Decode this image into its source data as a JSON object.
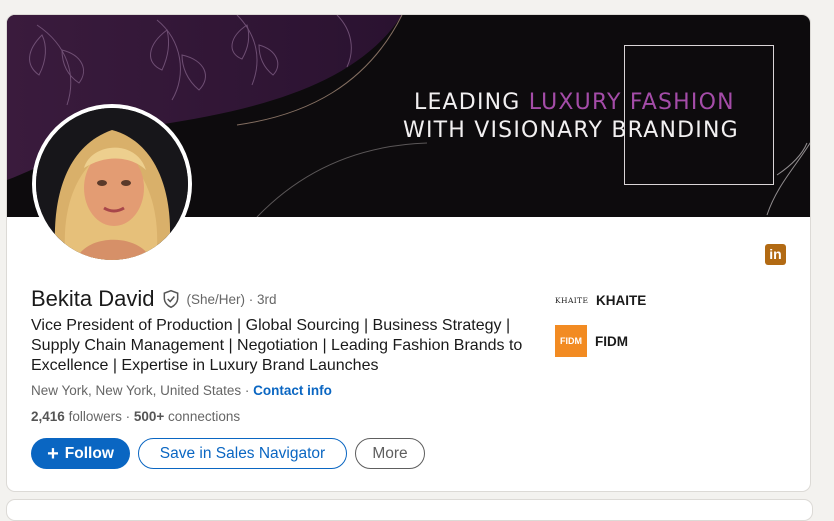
{
  "banner": {
    "line1_plain": "LEADING ",
    "line1_accent": "LUXURY FASHION",
    "line2": "WITH VISIONARY BRANDING",
    "accent_color": "#a44ca8"
  },
  "profile": {
    "name": "Bekita David",
    "pronouns": "(She/Her)",
    "degree": "· 3rd",
    "headline": "Vice President of Production | Global Sourcing | Business Strategy | Supply Chain Management | Negotiation | Leading Fashion Brands to Excellence | Expertise in Luxury Brand Launches",
    "location": "New York, New York, United States",
    "separator": " · ",
    "contact_link": "Contact info",
    "followers_count": "2,416",
    "followers_label": "followers",
    "connections_prefix": " · ",
    "connections_count": "500+",
    "connections_label": "connections",
    "verified_icon": "shield-check-icon"
  },
  "actions": {
    "follow_label": "Follow",
    "save_label": "Save in Sales Navigator",
    "more_label": "More",
    "brand_color": "#0a66c2"
  },
  "organizations": [
    {
      "logo_text": "KHAITE",
      "name": "KHAITE"
    },
    {
      "logo_text": "FIDM",
      "name": "FIDM",
      "logo_color": "#f28b22"
    }
  ],
  "linkedin_badge": "in"
}
